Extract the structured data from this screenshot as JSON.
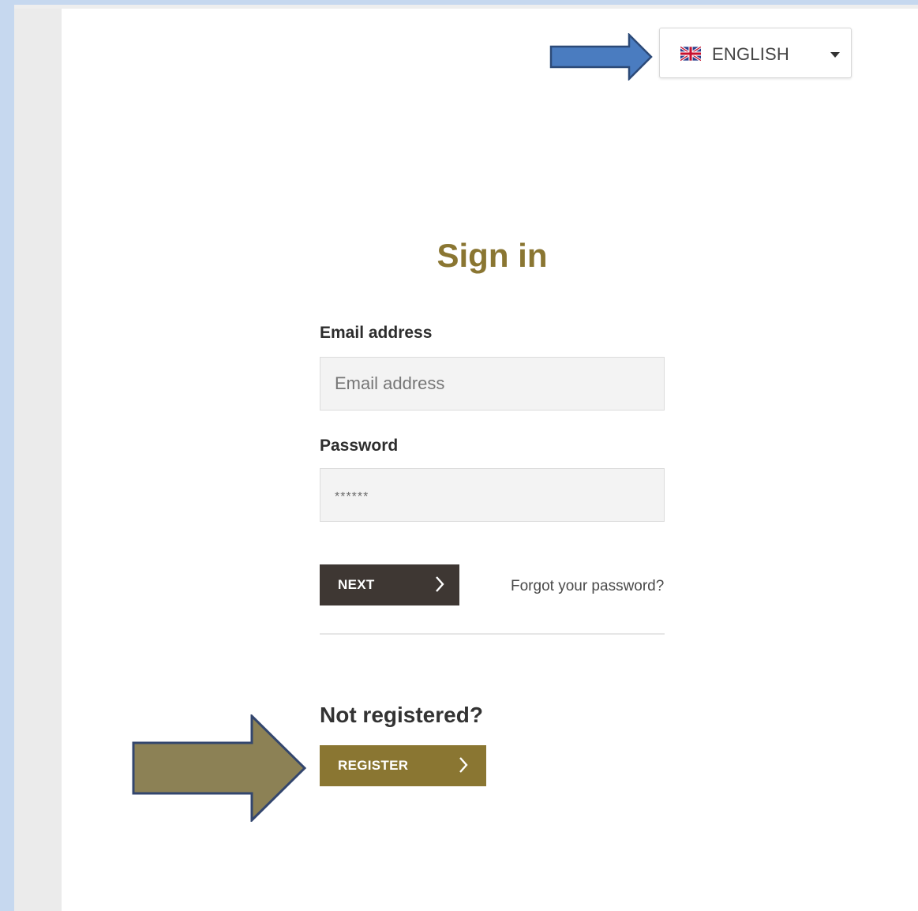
{
  "language": {
    "selected": "ENGLISH",
    "flag_icon": "uk-flag-icon"
  },
  "form": {
    "title": "Sign in",
    "email": {
      "label": "Email address",
      "placeholder": "Email address"
    },
    "password": {
      "label": "Password",
      "placeholder": "******"
    },
    "next_label": "NEXT",
    "forgot_label": "Forgot your password?"
  },
  "register": {
    "heading": "Not registered?",
    "button_label": "REGISTER"
  },
  "colors": {
    "accent": "#8a7632",
    "dark_button": "#3e3733",
    "annotation_blue": "#4a7cc0",
    "annotation_olive": "#8c8155"
  }
}
